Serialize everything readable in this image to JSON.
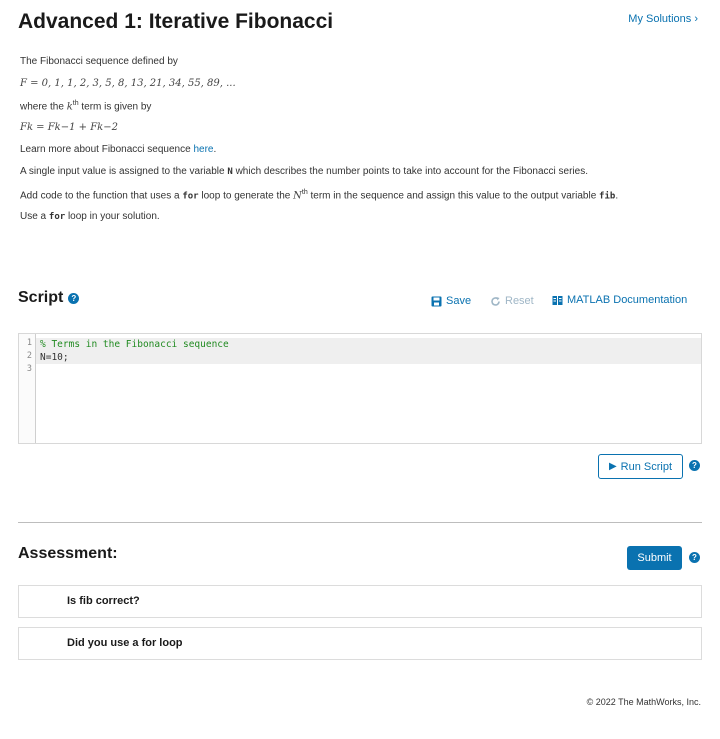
{
  "header": {
    "title": "Advanced 1: Iterative Fibonacci",
    "my_solutions": "My Solutions"
  },
  "description": {
    "line1": "The Fibonacci sequence defined by",
    "sequence": "F = 0, 1, 1, 2, 3, 5, 8, 13, 21, 34, 55, 89, ...",
    "line3_prefix": "where the",
    "line3_var": "k",
    "line3_sup": "th",
    "line3_suffix": "term is given by",
    "formula": "Fk = Fk−1 + Fk−2",
    "learn_prefix": "Learn more about Fibonacci sequence",
    "learn_link": "here",
    "learn_suffix": ".",
    "input_prefix": "A single input value is assigned to the variable",
    "input_var": "N",
    "input_suffix": "which describes the number points to take into account for the Fibonacci series.",
    "add_prefix": "Add code to the function that uses a",
    "add_kw": "for",
    "add_mid": "loop to generate the",
    "add_var": "N",
    "add_sup": "th",
    "add_mid2": "term in the sequence and assign this value to the output variable",
    "add_out": "fib",
    "add_end": ".",
    "use_prefix": "Use a",
    "use_kw": "for",
    "use_suffix": "loop in your solution."
  },
  "script": {
    "title": "Script",
    "save_label": "Save",
    "reset_label": "Reset",
    "docs_label": "MATLAB Documentation",
    "run_label": "Run Script",
    "lines": [
      {
        "num": "1",
        "code": "% Terms in the Fibonacci sequence"
      },
      {
        "num": "2",
        "code": "N=10;"
      },
      {
        "num": "3",
        "code": ""
      }
    ]
  },
  "assessment": {
    "title": "Assessment:",
    "submit_label": "Submit",
    "tests": [
      {
        "label": "Is fib correct?"
      },
      {
        "label": "Did you use a for loop"
      }
    ]
  },
  "footer": {
    "copyright": "© 2022 The MathWorks, Inc."
  },
  "colors": {
    "accent": "#0a72b0",
    "comment": "#228b22"
  }
}
